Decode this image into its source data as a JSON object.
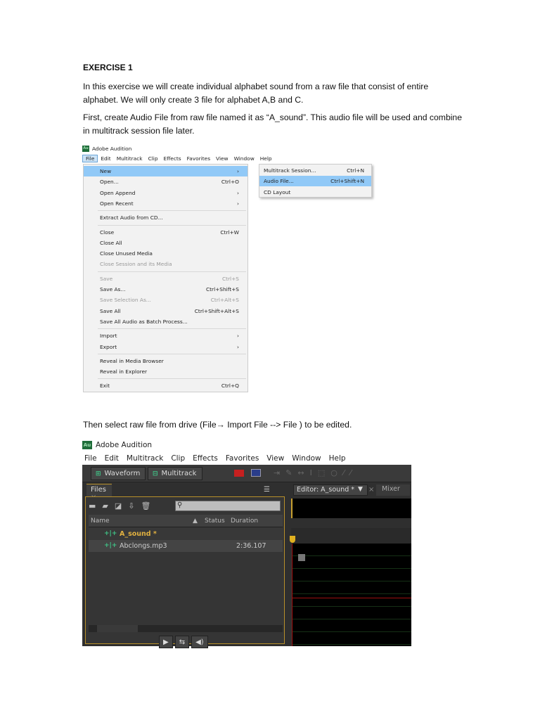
{
  "doc": {
    "heading": "EXERCISE 1",
    "para1": "In this exercise we will create individual alphabet sound from a raw file that consist of entire alphabet. We will only create 3 file for alphabet A,B and C.",
    "para2": "First, create Audio File from raw file named it as “A_sound”. This audio file will be used and combine in multitrack session file later.",
    "para3": "Then select raw file from drive (File→ Import File --> File ) to be edited."
  },
  "shot1": {
    "app_title": "Adobe Audition",
    "logo": "Au",
    "menubar": [
      "File",
      "Edit",
      "Multitrack",
      "Clip",
      "Effects",
      "Favorites",
      "View",
      "Window",
      "Help"
    ],
    "file_menu": [
      {
        "label": "New",
        "shortcut": "›",
        "highlight": true
      },
      {
        "label": "Open...",
        "shortcut": "Ctrl+O"
      },
      {
        "label": "Open Append",
        "shortcut": "›"
      },
      {
        "label": "Open Recent",
        "shortcut": "›",
        "sep_after": true
      },
      {
        "label": "Extract Audio from CD...",
        "shortcut": "",
        "sep_after": true
      },
      {
        "label": "Close",
        "shortcut": "Ctrl+W"
      },
      {
        "label": "Close All",
        "shortcut": ""
      },
      {
        "label": "Close Unused Media",
        "shortcut": ""
      },
      {
        "label": "Close Session and its Media",
        "shortcut": "",
        "disabled": true,
        "sep_after": true
      },
      {
        "label": "Save",
        "shortcut": "Ctrl+S",
        "disabled": true
      },
      {
        "label": "Save As...",
        "shortcut": "Ctrl+Shift+S"
      },
      {
        "label": "Save Selection As...",
        "shortcut": "Ctrl+Alt+S",
        "disabled": true
      },
      {
        "label": "Save All",
        "shortcut": "Ctrl+Shift+Alt+S"
      },
      {
        "label": "Save All Audio as Batch Process...",
        "shortcut": "",
        "sep_after": true
      },
      {
        "label": "Import",
        "shortcut": "›"
      },
      {
        "label": "Export",
        "shortcut": "›",
        "sep_after": true
      },
      {
        "label": "Reveal in Media Browser",
        "shortcut": ""
      },
      {
        "label": "Reveal in Explorer",
        "shortcut": "",
        "sep_after": true
      },
      {
        "label": "Exit",
        "shortcut": "Ctrl+Q"
      }
    ],
    "new_submenu": [
      {
        "label": "Multitrack Session...",
        "shortcut": "Ctrl+N"
      },
      {
        "label": "Audio File...",
        "shortcut": "Ctrl+Shift+N",
        "highlight": true
      },
      {
        "label": "CD Layout",
        "shortcut": ""
      }
    ]
  },
  "shot2": {
    "app_title": "Adobe Audition",
    "logo": "Au",
    "menubar": [
      "File",
      "Edit",
      "Multitrack",
      "Clip",
      "Effects",
      "Favorites",
      "View",
      "Window",
      "Help"
    ],
    "waveform_tab": "Waveform",
    "multitrack_tab": "Multitrack",
    "files_tab": "Files",
    "editor_tab": "Editor: A_sound *",
    "mixer_tab": "Mixer",
    "columns": {
      "name": "Name",
      "status": "Status",
      "duration": "Duration"
    },
    "files": [
      {
        "name": "A_sound *",
        "duration": "",
        "color": "#e0b040"
      },
      {
        "name": "Abclongs.mp3",
        "duration": "2:36.107",
        "color": "#cccccc"
      }
    ]
  }
}
